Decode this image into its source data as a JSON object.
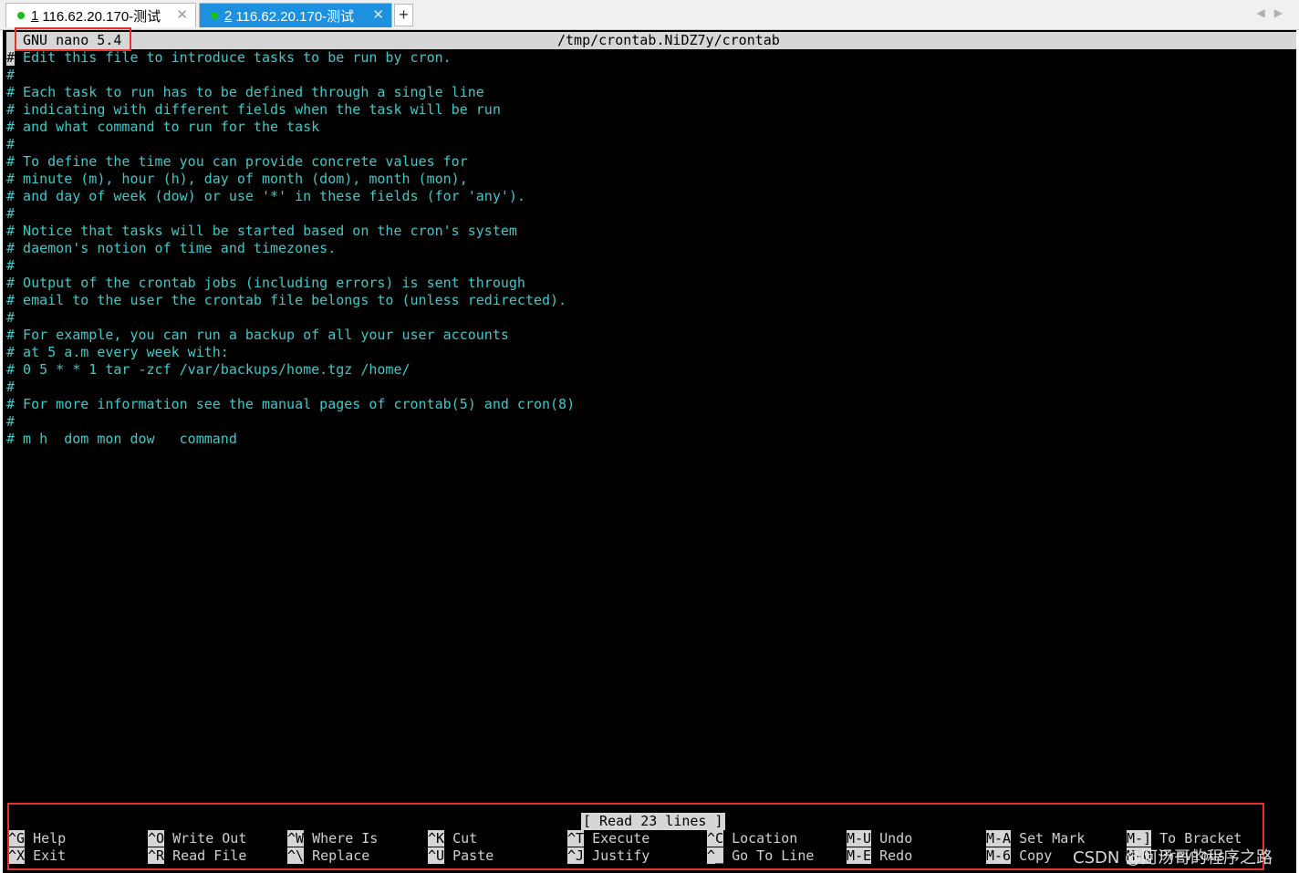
{
  "tabs": [
    {
      "number": "1",
      "label": "116.62.20.170-测试",
      "close": "✕"
    },
    {
      "number": "2",
      "label": "116.62.20.170-测试",
      "close": "✕"
    }
  ],
  "tabbar": {
    "new_tab": "+",
    "scroll_left": "◀",
    "scroll_right": "▶"
  },
  "nano": {
    "version": "GNU nano 5.4",
    "filename": "/tmp/crontab.NiDZ7y/crontab",
    "cursor_char": "#",
    "lines": [
      " Edit this file to introduce tasks to be run by cron.",
      "#",
      "# Each task to run has to be defined through a single line",
      "# indicating with different fields when the task will be run",
      "# and what command to run for the task",
      "#",
      "# To define the time you can provide concrete values for",
      "# minute (m), hour (h), day of month (dom), month (mon),",
      "# and day of week (dow) or use '*' in these fields (for 'any').",
      "#",
      "# Notice that tasks will be started based on the cron's system",
      "# daemon's notion of time and timezones.",
      "#",
      "# Output of the crontab jobs (including errors) is sent through",
      "# email to the user the crontab file belongs to (unless redirected).",
      "#",
      "# For example, you can run a backup of all your user accounts",
      "# at 5 a.m every week with:",
      "# 0 5 * * 1 tar -zcf /var/backups/home.tgz /home/",
      "#",
      "# For more information see the manual pages of crontab(5) and cron(8)",
      "#",
      "# m h  dom mon dow   command"
    ],
    "status": "[ Read 23 lines ]",
    "shortcuts": [
      [
        {
          "key": "^G",
          "label": " Help"
        },
        {
          "key": "^X",
          "label": " Exit"
        }
      ],
      [
        {
          "key": "^O",
          "label": " Write Out"
        },
        {
          "key": "^R",
          "label": " Read File"
        }
      ],
      [
        {
          "key": "^W",
          "label": " Where Is"
        },
        {
          "key": "^\\",
          "label": " Replace"
        }
      ],
      [
        {
          "key": "^K",
          "label": " Cut"
        },
        {
          "key": "^U",
          "label": " Paste"
        }
      ],
      [
        {
          "key": "^T",
          "label": " Execute"
        },
        {
          "key": "^J",
          "label": " Justify"
        }
      ],
      [
        {
          "key": "^C",
          "label": " Location"
        },
        {
          "key": "^_",
          "label": " Go To Line"
        }
      ],
      [
        {
          "key": "M-U",
          "label": " Undo"
        },
        {
          "key": "M-E",
          "label": " Redo"
        }
      ],
      [
        {
          "key": "M-A",
          "label": " Set Mark"
        },
        {
          "key": "M-6",
          "label": " Copy"
        }
      ],
      [
        {
          "key": "M-]",
          "label": " To Bracket"
        },
        {
          "key": "M-Q",
          "label": " Previous"
        }
      ]
    ]
  },
  "watermark": "CSDN @阿汤哥的程序之路",
  "colors": {
    "terminal_bg": "#000000",
    "comment_text": "#3fc8c8",
    "highlight_bar": "#d6d6d6",
    "active_tab": "#1e90e0",
    "annotation": "#e5322d"
  }
}
